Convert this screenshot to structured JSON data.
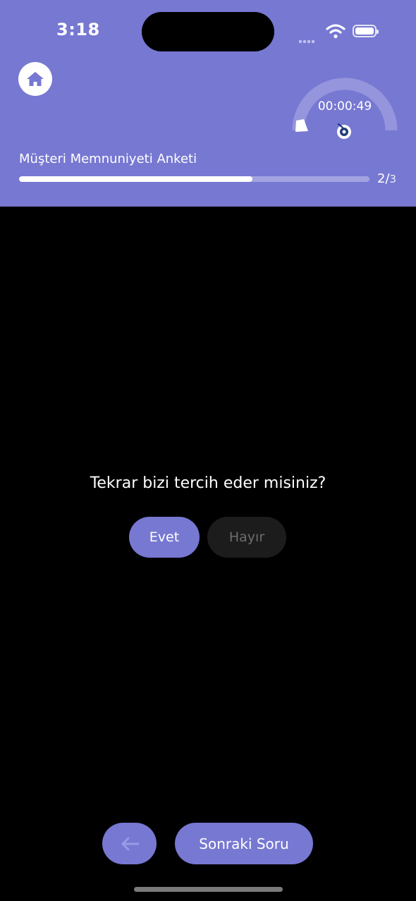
{
  "status_bar": {
    "time": "3:18",
    "wifi_icon": "wifi-icon",
    "battery_icon": "battery-icon"
  },
  "header": {
    "background": "#7778d2",
    "home_icon": "home-icon",
    "timer": "00:00:49",
    "survey_title": "Müşteri Memnuniyeti Anketi",
    "progress": {
      "current": "2",
      "separator": "/",
      "total": "3",
      "fraction": 0.667
    }
  },
  "question": {
    "text": "Tekrar bizi tercih eder misiniz?",
    "options": [
      {
        "label": "Evet",
        "selected": true
      },
      {
        "label": "Hayır",
        "selected": false
      }
    ]
  },
  "footer": {
    "back_icon": "arrow-left-icon",
    "next_label": "Sonraki Soru"
  }
}
